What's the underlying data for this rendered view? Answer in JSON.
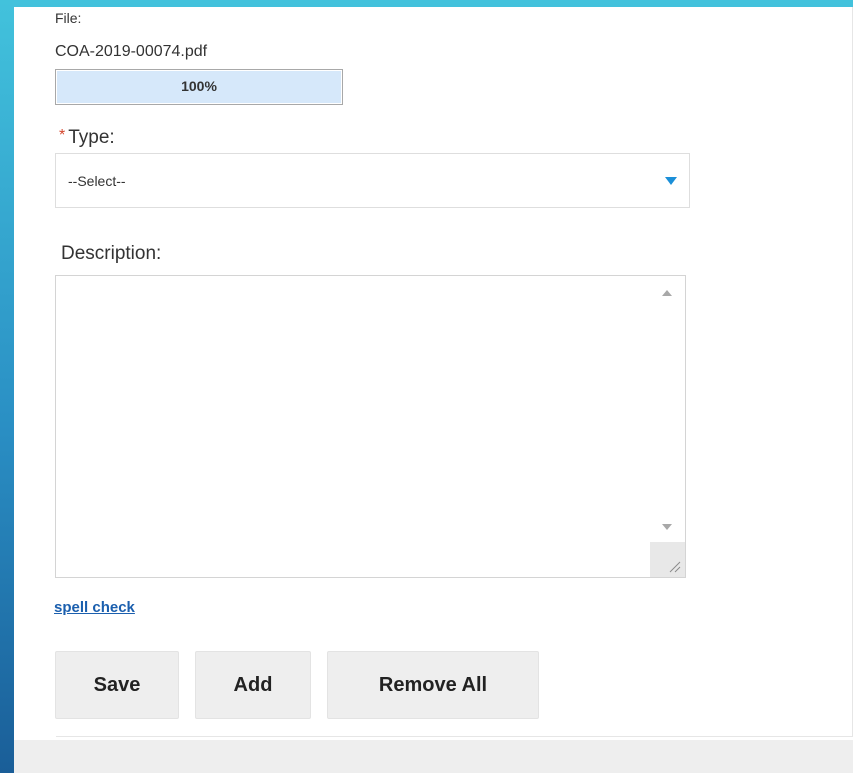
{
  "file": {
    "label": "File:",
    "name": "COA-2019-00074.pdf",
    "progress_percent": 100,
    "progress_text": "100%"
  },
  "type_field": {
    "required_marker": "*",
    "label": "Type:",
    "selected_value": "--Select--"
  },
  "description_field": {
    "label": "Description:",
    "value": ""
  },
  "spell_check": {
    "label": "spell check"
  },
  "buttons": {
    "save": "Save",
    "add": "Add",
    "remove_all": "Remove All"
  },
  "colors": {
    "progress_fill": "#d6e8fa",
    "select_arrow": "#1b8fd8",
    "required_star": "#d4452c",
    "link": "#1b5fae"
  }
}
